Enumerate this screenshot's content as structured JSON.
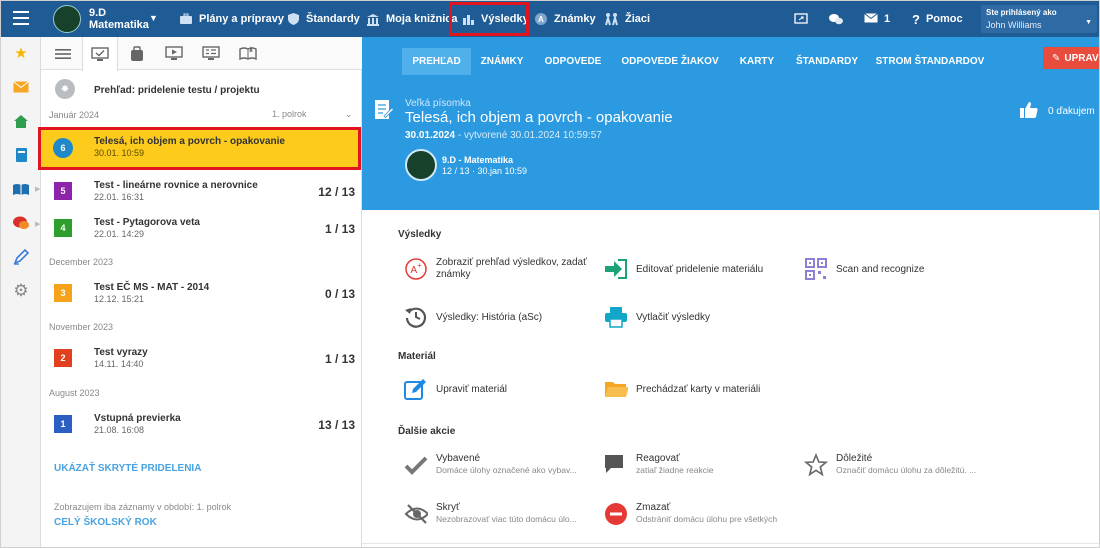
{
  "topbar": {
    "class_name_line1": "9.D",
    "class_name_line2": "Matematika",
    "nav": [
      {
        "label": "Plány a prípravy",
        "icon": "briefcase-icon"
      },
      {
        "label": "Štandardy",
        "icon": "shield-icon"
      },
      {
        "label": "Moja knižnica",
        "icon": "library-icon"
      },
      {
        "label": "Výsledky",
        "icon": "bar-chart-icon"
      },
      {
        "label": "Známky",
        "icon": "grade-icon"
      },
      {
        "label": "Žiaci",
        "icon": "students-icon"
      }
    ],
    "messages_count": "1",
    "help_label": "Pomoc",
    "logged_in_label": "Ste prihlásený ako",
    "user_name": "John Williams"
  },
  "list": {
    "overview_label": "Prehľad: pridelenie testu / projektu",
    "period_label": "1. polrok",
    "groups": [
      {
        "month": "Január 2024"
      },
      {
        "month": "December 2023"
      },
      {
        "month": "November 2023"
      },
      {
        "month": "August 2023"
      }
    ],
    "items": [
      {
        "num": "6",
        "title": "Telesá, ich objem a povrch - opakovanie",
        "date": "30.01. 10:59",
        "score": "",
        "color": "#1e88c8"
      },
      {
        "num": "5",
        "title": "Test - lineárne rovnice a nerovnice",
        "date": "22.01. 16:31",
        "score": "12 / 13",
        "color": "#8e24aa"
      },
      {
        "num": "4",
        "title": "Test - Pytagorova veta",
        "date": "22.01. 14:29",
        "score": "1 / 13",
        "color": "#2e9e2e"
      },
      {
        "num": "3",
        "title": "Test EČ MS - MAT - 2014",
        "date": "12.12. 15:21",
        "score": "0 / 13",
        "color": "#f7a21b"
      },
      {
        "num": "2",
        "title": "Test vyrazy",
        "date": "14.11. 14:40",
        "score": "1 / 13",
        "color": "#e0401e"
      },
      {
        "num": "1",
        "title": "Vstupná previerka",
        "date": "21.08. 16:08",
        "score": "13 / 13",
        "color": "#2c5fc4"
      }
    ],
    "show_hidden": "UKÁZAŤ SKRYTÉ PRIDELENIA",
    "period_note": "Zobrazujem iba záznamy v období: 1. polrok",
    "whole_year": "CELÝ ŠKOLSKÝ ROK"
  },
  "subnav": {
    "tabs": [
      "PREHĽAD",
      "ZNÁMKY",
      "ODPOVEDE",
      "ODPOVEDE ŽIAKOV",
      "KARTY",
      "ŠTANDARDY",
      "STROM ŠTANDARDOV"
    ],
    "edit_label": "UPRAV"
  },
  "hero": {
    "kind": "Veľká písomka",
    "title": "Telesá, ich objem a povrch - opakovanie",
    "date": "30.01.2024",
    "created": " - vytvorené 30.01.2024 10:59:57",
    "class_label": "9.D - Matematika",
    "class_meta": "12 / 13 · 30.jan 10:59",
    "thanks": "0 ďakujem"
  },
  "sections": {
    "results": {
      "heading": "Výsledky",
      "actions": [
        {
          "label": "Zobraziť prehľad výsledkov, zadať",
          "label2": "známky",
          "icon": "grade-circle-icon"
        },
        {
          "label": "Editovať pridelenie materiálu",
          "icon": "enter-icon"
        },
        {
          "label": "Scan and recognize",
          "icon": "qr-icon"
        },
        {
          "label": "Výsledky: História (aSc)",
          "icon": "history-icon"
        },
        {
          "label": "Vytlačiť výsledky",
          "icon": "printer-icon"
        }
      ]
    },
    "material": {
      "heading": "Materiál",
      "actions": [
        {
          "label": "Upraviť materiál",
          "icon": "edit-icon"
        },
        {
          "label": "Prechádzať karty v materiáli",
          "icon": "folder-icon"
        }
      ]
    },
    "more": {
      "heading": "Ďalšie akcie",
      "actions": [
        {
          "label": "Vybavené",
          "sub": "Domáce úlohy označené ako vybav...",
          "icon": "check-icon"
        },
        {
          "label": "Reagovať",
          "sub": "zatiaľ žiadne reakcie",
          "icon": "chat-icon"
        },
        {
          "label": "Dôležité",
          "sub": "Označiť domácu úlohu za dôležitú. ...",
          "icon": "star-outline-icon"
        },
        {
          "label": "Skryť",
          "sub": "Nezobrazovať viac túto domácu úlo...",
          "icon": "eye-off-icon"
        },
        {
          "label": "Zmazať",
          "sub": "Odstrániť domácu úlohu pre všetkých",
          "icon": "delete-icon"
        }
      ]
    }
  }
}
